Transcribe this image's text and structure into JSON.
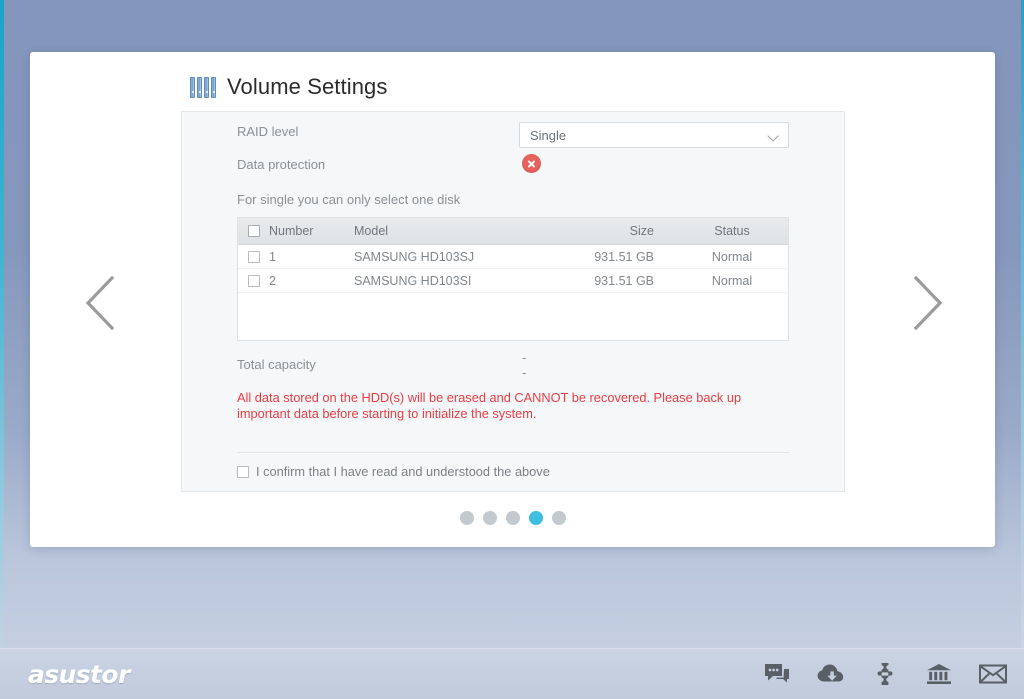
{
  "window": {
    "background_color": "#8496bb",
    "accent_color": "#3fbfe0"
  },
  "header": {
    "title": "Volume Settings",
    "icon": "disk-bays-icon"
  },
  "form": {
    "raid_level": {
      "label": "RAID level",
      "value": "Single",
      "dropdown_icon": "chevron-down-icon"
    },
    "data_protection": {
      "label": "Data protection",
      "status_icon": "error-circle-x-icon",
      "status_color": "#e8625c"
    },
    "hint": "For single you can only select one disk",
    "total_capacity": {
      "label": "Total capacity",
      "value": "--"
    },
    "warning": "All data stored on the HDD(s) will be erased and CANNOT be recovered. Please back up important data before starting to initialize the system.",
    "warning_color": "#ee3d41",
    "confirm": {
      "label": "I confirm that I have read and understood the above",
      "checked": false
    }
  },
  "disk_table": {
    "columns": [
      "",
      "Number",
      "Model",
      "Size",
      "Status"
    ],
    "rows": [
      {
        "number": "1",
        "model": "SAMSUNG HD103SJ",
        "size": "931.51 GB",
        "status": "Normal",
        "checked": false
      },
      {
        "number": "2",
        "model": "SAMSUNG HD103SI",
        "size": "931.51 GB",
        "status": "Normal",
        "checked": false
      }
    ],
    "select_all_checked": false
  },
  "pagination": {
    "total": 5,
    "active_index": 4,
    "active_color": "#3fbfe0",
    "inactive_color": "#c4c9cd"
  },
  "navigation": {
    "prev_label": "chevron-left-icon",
    "next_label": "chevron-right-icon"
  },
  "taskbar": {
    "brand": "asustor",
    "icons": [
      {
        "name": "chat-icon"
      },
      {
        "name": "cloud-download-icon"
      },
      {
        "name": "app-central-puzzle-icon"
      },
      {
        "name": "bank-columns-icon"
      },
      {
        "name": "mail-envelope-icon"
      }
    ]
  }
}
